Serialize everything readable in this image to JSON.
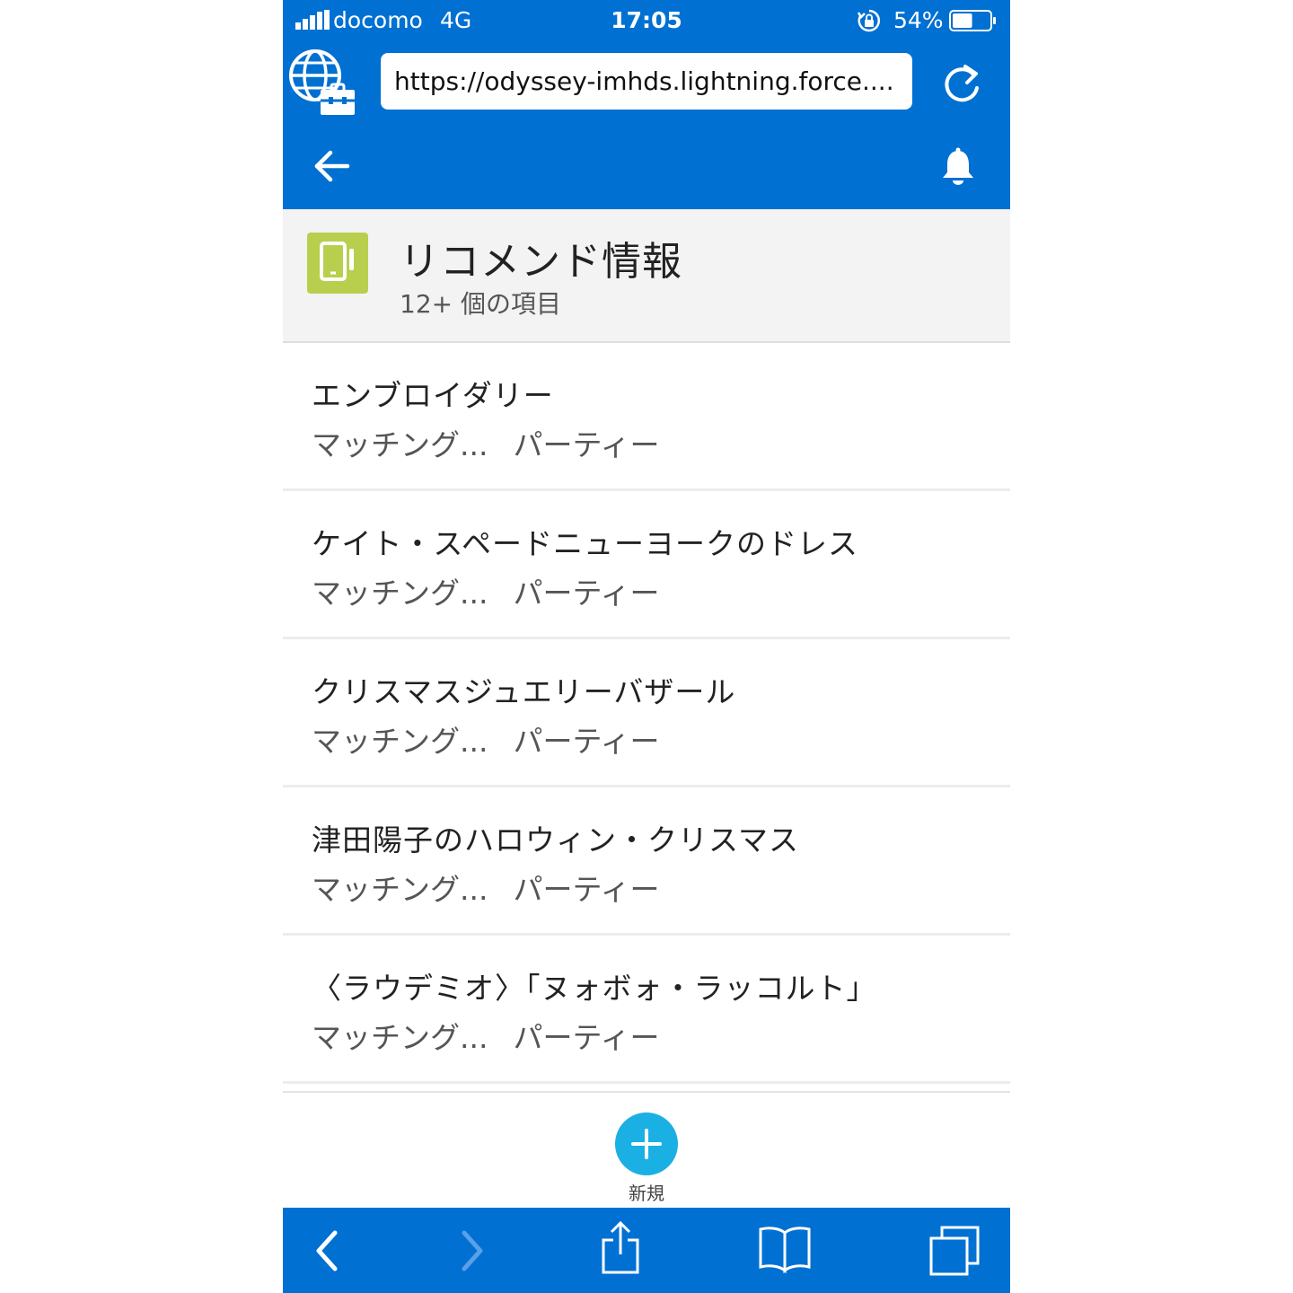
{
  "status_bar": {
    "carrier": "docomo",
    "network": "4G",
    "time": "17:05",
    "battery_percent": "54%",
    "battery_level": 0.54
  },
  "browser": {
    "url": "https://odyssey-imhds.lightning.force...."
  },
  "list_view": {
    "title": "リコメンド情報",
    "count": "12+ 個の項目",
    "icon": "tablet-icon",
    "icon_color": "#b8cf4e"
  },
  "records": [
    {
      "title": "エンブロイダリー",
      "field1": "マッチング...",
      "field2": "パーティー"
    },
    {
      "title": "ケイト・スペードニューヨークのドレス",
      "field1": "マッチング...",
      "field2": "パーティー"
    },
    {
      "title": "クリスマスジュエリーバザール",
      "field1": "マッチング...",
      "field2": "パーティー"
    },
    {
      "title": "津田陽子のハロウィン・クリスマス",
      "field1": "マッチング...",
      "field2": "パーティー"
    },
    {
      "title": "〈ラウデミオ〉「ヌォボォ・ラッコルト」",
      "field1": "マッチング...",
      "field2": "パーティー"
    }
  ],
  "actions": {
    "new_label": "新規"
  },
  "colors": {
    "brand_blue": "#0070d2",
    "new_button": "#1bb0e3"
  }
}
